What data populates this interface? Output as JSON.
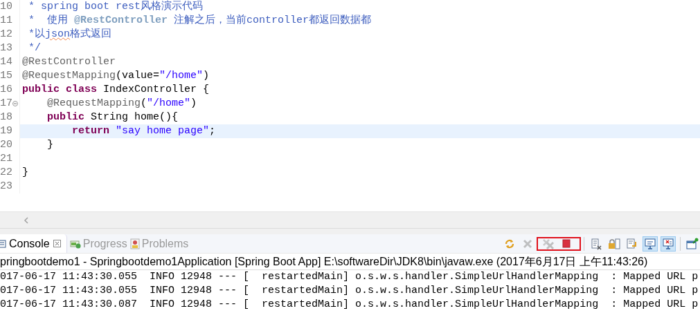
{
  "editor": {
    "lines": [
      {
        "number": "10",
        "current": false,
        "foldable": false,
        "tokens": [
          {
            "kind": "comment",
            "text": " * spring boot rest风格演示代码"
          }
        ]
      },
      {
        "number": "11",
        "current": false,
        "foldable": false,
        "tokens": [
          {
            "kind": "comment",
            "text": " *  使用 "
          },
          {
            "kind": "doc-tag",
            "text": "@RestController"
          },
          {
            "kind": "comment",
            "text": " 注解之后，当前controller都返回数据都"
          }
        ]
      },
      {
        "number": "12",
        "current": false,
        "foldable": false,
        "tokens": [
          {
            "kind": "comment",
            "text": " *以"
          },
          {
            "kind": "comment-misspelled",
            "text": "json"
          },
          {
            "kind": "comment",
            "text": "格式返回"
          }
        ]
      },
      {
        "number": "13",
        "current": false,
        "foldable": false,
        "tokens": [
          {
            "kind": "comment",
            "text": " */"
          }
        ]
      },
      {
        "number": "14",
        "current": false,
        "foldable": false,
        "tokens": [
          {
            "kind": "annotation",
            "text": "@RestController"
          }
        ]
      },
      {
        "number": "15",
        "current": false,
        "foldable": false,
        "tokens": [
          {
            "kind": "annotation",
            "text": "@RequestMapping"
          },
          {
            "kind": "plain",
            "text": "(value="
          },
          {
            "kind": "string",
            "text": "\"/home\""
          },
          {
            "kind": "plain",
            "text": ")"
          }
        ]
      },
      {
        "number": "16",
        "current": false,
        "foldable": false,
        "tokens": [
          {
            "kind": "keyword",
            "text": "public "
          },
          {
            "kind": "keyword",
            "text": "class "
          },
          {
            "kind": "plain",
            "text": "IndexController {"
          }
        ]
      },
      {
        "number": "17",
        "current": false,
        "foldable": true,
        "tokens": [
          {
            "kind": "annotation",
            "text": "    @RequestMapping"
          },
          {
            "kind": "plain",
            "text": "("
          },
          {
            "kind": "string",
            "text": "\"/home\""
          },
          {
            "kind": "plain",
            "text": ")"
          }
        ]
      },
      {
        "number": "18",
        "current": false,
        "foldable": false,
        "tokens": [
          {
            "kind": "keyword",
            "text": "    public "
          },
          {
            "kind": "plain",
            "text": "String home(){"
          }
        ]
      },
      {
        "number": "19",
        "current": true,
        "foldable": false,
        "tokens": [
          {
            "kind": "keyword",
            "text": "        return "
          },
          {
            "kind": "string",
            "text": "\"say home page\""
          },
          {
            "kind": "plain",
            "text": ";"
          }
        ]
      },
      {
        "number": "20",
        "current": false,
        "foldable": false,
        "tokens": [
          {
            "kind": "plain",
            "text": "    }"
          }
        ]
      },
      {
        "number": "21",
        "current": false,
        "foldable": false
      },
      {
        "number": "22",
        "current": false,
        "foldable": false,
        "tokens": [
          {
            "kind": "plain",
            "text": "}"
          }
        ]
      },
      {
        "number": "23",
        "current": false,
        "foldable": false
      }
    ]
  },
  "console": {
    "tabs": [
      {
        "label": "Console",
        "kind": "console",
        "selected": true
      },
      {
        "label": "Progress",
        "kind": "progress",
        "selected": false
      },
      {
        "label": "Problems",
        "kind": "problems",
        "selected": false
      }
    ],
    "toolbar": [
      {
        "kind": "sync",
        "disabled": false,
        "pressed": false,
        "highlighted": false
      },
      {
        "kind": "remove-launch",
        "disabled": true,
        "pressed": false,
        "highlighted": false
      },
      {
        "kind": "remove-all",
        "disabled": true,
        "pressed": false,
        "highlighted": true
      },
      {
        "kind": "terminate",
        "disabled": false,
        "pressed": false,
        "highlighted": true
      },
      {
        "kind": "clear",
        "disabled": false,
        "pressed": false,
        "highlighted": false
      },
      {
        "kind": "scroll-lock",
        "disabled": false,
        "pressed": false,
        "highlighted": false
      },
      {
        "kind": "word-wrap",
        "disabled": false,
        "pressed": false,
        "highlighted": false
      },
      {
        "kind": "show-on-output",
        "disabled": false,
        "pressed": true,
        "highlighted": false
      },
      {
        "kind": "show-on-error",
        "disabled": false,
        "pressed": true,
        "highlighted": false
      },
      {
        "kind": "pin",
        "disabled": false,
        "pressed": false,
        "highlighted": false
      }
    ],
    "header": "pringbootdemo1 - Springbootdemo1Application [Spring Boot App] E:\\softwareDir\\JDK8\\bin\\javaw.exe (2017年6月17日 上午11:43:26)",
    "log_lines": [
      "017-06-17 11:43:30.055  INFO 12948 --- [  restartedMain] o.s.w.s.handler.SimpleUrlHandlerMapping  : Mapped URL p",
      "017-06-17 11:43:30.055  INFO 12948 --- [  restartedMain] o.s.w.s.handler.SimpleUrlHandlerMapping  : Mapped URL p",
      "017-06-17 11:43:30.087  INFO 12948 --- [  restartedMain] o.s.w.s.handler.SimpleUrlHandlerMapping  : Mapped URL p"
    ]
  }
}
